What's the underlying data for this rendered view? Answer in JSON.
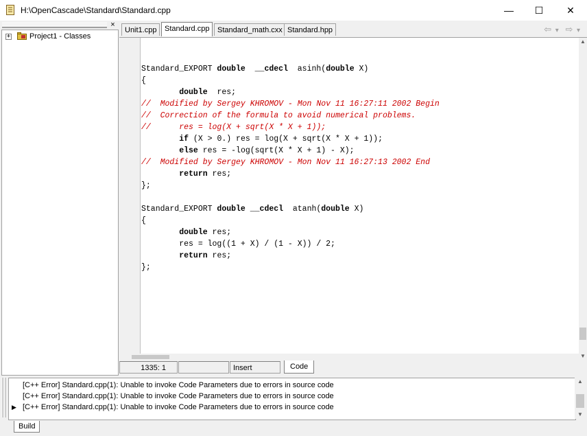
{
  "window": {
    "title": "H:\\OpenCascade\\Standard\\Standard.cpp",
    "minimize": "—",
    "maximize": "☐",
    "close": "✕"
  },
  "left_pane": {
    "close": "×",
    "tree": [
      {
        "label": "Project1 - Classes",
        "expander": "+"
      }
    ]
  },
  "tabs": [
    {
      "label": "Unit1.cpp",
      "active": false
    },
    {
      "label": "Standard.cpp",
      "active": true
    },
    {
      "label": "Standard_math.cxx",
      "active": false
    },
    {
      "label": "Standard.hpp",
      "active": false
    }
  ],
  "nav": {
    "back": "⇦",
    "back_dropdown": "▾",
    "forward": "⇨",
    "forward_dropdown": "▾"
  },
  "code_lines": [
    [],
    [
      {
        "t": "Standard_EXPORT "
      },
      {
        "t": "double",
        "c": "kw"
      },
      {
        "t": "  "
      },
      {
        "t": "__cdecl",
        "c": "kw"
      },
      {
        "t": "  asinh("
      },
      {
        "t": "double",
        "c": "kw"
      },
      {
        "t": " X)"
      }
    ],
    [
      {
        "t": "{"
      }
    ],
    [
      {
        "t": "        "
      },
      {
        "t": "double",
        "c": "kw"
      },
      {
        "t": "  res;"
      }
    ],
    [
      {
        "t": "//  Modified by Sergey KHROMOV - Mon Nov 11 16:27:11 2002 Begin",
        "c": "cm"
      }
    ],
    [
      {
        "t": "//  Correction of the formula to avoid numerical problems.",
        "c": "cm"
      }
    ],
    [
      {
        "t": "//      res = log(X + sqrt(X * X + 1));",
        "c": "cm"
      }
    ],
    [
      {
        "t": "        "
      },
      {
        "t": "if",
        "c": "kw"
      },
      {
        "t": " (X > 0.) res = log(X + sqrt(X * X + 1));"
      }
    ],
    [
      {
        "t": "        "
      },
      {
        "t": "else",
        "c": "kw"
      },
      {
        "t": " res = -log(sqrt(X * X + 1) - X);"
      }
    ],
    [
      {
        "t": "//  Modified by Sergey KHROMOV - Mon Nov 11 16:27:13 2002 End",
        "c": "cm"
      }
    ],
    [
      {
        "t": "        "
      },
      {
        "t": "return",
        "c": "kw"
      },
      {
        "t": " res;"
      }
    ],
    [
      {
        "t": "};"
      }
    ],
    [],
    [
      {
        "t": "Standard_EXPORT "
      },
      {
        "t": "double",
        "c": "kw"
      },
      {
        "t": " "
      },
      {
        "t": "__cdecl",
        "c": "kw"
      },
      {
        "t": "  atanh("
      },
      {
        "t": "double",
        "c": "kw"
      },
      {
        "t": " X)"
      }
    ],
    [
      {
        "t": "{"
      }
    ],
    [
      {
        "t": "        "
      },
      {
        "t": "double",
        "c": "kw"
      },
      {
        "t": " res;"
      }
    ],
    [
      {
        "t": "        res = log((1 + X) / (1 - X)) / 2;"
      }
    ],
    [
      {
        "t": "        "
      },
      {
        "t": "return",
        "c": "kw"
      },
      {
        "t": " res;"
      }
    ],
    [
      {
        "t": "};"
      }
    ]
  ],
  "status": {
    "position": "1335:   1",
    "cell2": "",
    "mode": "Insert",
    "view_tab": "Code"
  },
  "messages": [
    {
      "text": "[C++ Error] Standard.cpp(1): Unable to invoke Code Parameters due to errors in source code",
      "selected": false
    },
    {
      "text": "[C++ Error] Standard.cpp(1): Unable to invoke Code Parameters due to errors in source code",
      "selected": false
    },
    {
      "text": "[C++ Error] Standard.cpp(1): Unable to invoke Code Parameters due to errors in source code",
      "selected": true
    }
  ],
  "message_tab": "Build",
  "colors": {
    "comment": "#cc0000",
    "accent": "#000000"
  }
}
